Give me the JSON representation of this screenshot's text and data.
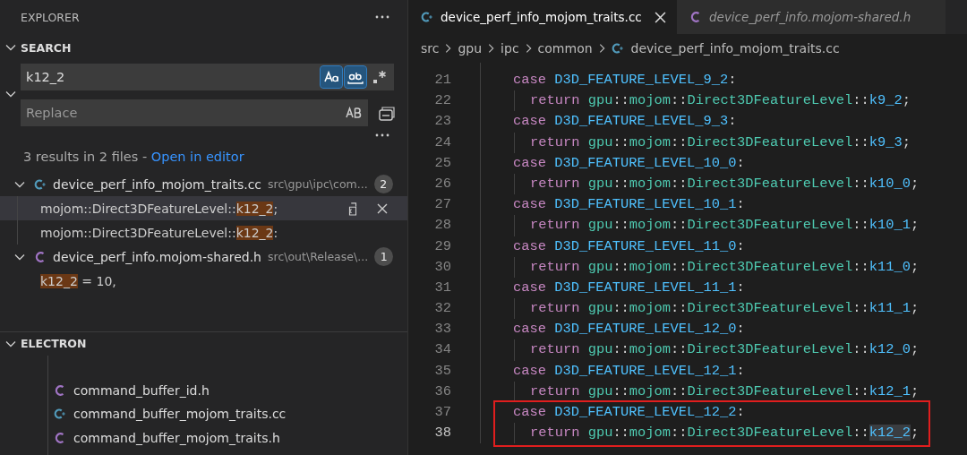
{
  "sidebar": {
    "title": "EXPLORER",
    "search": {
      "heading": "SEARCH",
      "expanded": true,
      "query": "k12_2",
      "match_case": true,
      "whole_word": true,
      "use_regex": false,
      "replace_expanded": true,
      "replace_placeholder": "Replace",
      "preserve_case": false,
      "summary": "3 results in 2 files - ",
      "open_link": "Open in editor",
      "results": [
        {
          "file": "device_perf_info_mojom_traits.cc",
          "kind": "cpp",
          "path": "src\\gpu\\ipc\\com...",
          "count": "2",
          "expanded": true,
          "matches": [
            {
              "before": "mojom::Direct3DFeatureLevel::",
              "match": "k12_2",
              "after": ";",
              "selected": true
            },
            {
              "before": "mojom::Direct3DFeatureLevel::",
              "match": "k12_2",
              "after": ":",
              "selected": false
            }
          ]
        },
        {
          "file": "device_perf_info.mojom-shared.h",
          "kind": "c",
          "path": "src\\out\\Release\\...",
          "count": "1",
          "expanded": true,
          "matches": [
            {
              "match": "k12_2",
              "after": " = 10,",
              "selected": false
            }
          ]
        }
      ]
    },
    "electron": {
      "heading": "ELECTRON",
      "expanded": true,
      "files": [
        {
          "name": "command_buffer_id.h",
          "kind": "c"
        },
        {
          "name": "command_buffer_mojom_traits.cc",
          "kind": "cpp"
        },
        {
          "name": "command_buffer_mojom_traits.h",
          "kind": "c"
        }
      ]
    }
  },
  "editor": {
    "tabs": [
      {
        "label": "device_perf_info_mojom_traits.cc",
        "kind": "cpp",
        "selected": true,
        "preview": false
      },
      {
        "label": "device_perf_info.mojom-shared.h",
        "kind": "c",
        "selected": false,
        "preview": true
      }
    ],
    "breadcrumbs": [
      {
        "label": "src"
      },
      {
        "label": "gpu"
      },
      {
        "label": "ipc"
      },
      {
        "label": "common"
      },
      {
        "label": "device_perf_info_mojom_traits.cc",
        "kind": "cpp"
      }
    ],
    "lines": [
      {
        "number": "21",
        "kind": "case",
        "current": false,
        "framed": false,
        "tokens": [
          {
            "text": "case",
            "kind": "keyword"
          },
          {
            "text": "D3D_FEATURE_LEVEL_9_2",
            "kind": "macro"
          },
          {
            "text": ":",
            "kind": "plain"
          }
        ]
      },
      {
        "number": "22",
        "kind": "return",
        "current": false,
        "framed": false,
        "tokens": [
          {
            "text": "return",
            "kind": "keyword"
          },
          {
            "text": "gpu",
            "kind": "type"
          },
          {
            "text": "::",
            "kind": "plain"
          },
          {
            "text": "mojom",
            "kind": "type"
          },
          {
            "text": "::",
            "kind": "plain"
          },
          {
            "text": "Direct3DFeatureLevel",
            "kind": "type"
          },
          {
            "text": "::",
            "kind": "plain"
          },
          {
            "text": "k9_2",
            "kind": "enum"
          },
          {
            "text": ";",
            "kind": "plain"
          }
        ]
      },
      {
        "number": "23",
        "kind": "case",
        "current": false,
        "framed": false,
        "tokens": [
          {
            "text": "case",
            "kind": "keyword"
          },
          {
            "text": "D3D_FEATURE_LEVEL_9_3",
            "kind": "macro"
          },
          {
            "text": ":",
            "kind": "plain"
          }
        ]
      },
      {
        "number": "24",
        "kind": "return",
        "current": false,
        "framed": false,
        "tokens": [
          {
            "text": "return",
            "kind": "keyword"
          },
          {
            "text": "gpu",
            "kind": "type"
          },
          {
            "text": "::",
            "kind": "plain"
          },
          {
            "text": "mojom",
            "kind": "type"
          },
          {
            "text": "::",
            "kind": "plain"
          },
          {
            "text": "Direct3DFeatureLevel",
            "kind": "type"
          },
          {
            "text": "::",
            "kind": "plain"
          },
          {
            "text": "k9_3",
            "kind": "enum"
          },
          {
            "text": ";",
            "kind": "plain"
          }
        ]
      },
      {
        "number": "25",
        "kind": "case",
        "current": false,
        "framed": false,
        "tokens": [
          {
            "text": "case",
            "kind": "keyword"
          },
          {
            "text": "D3D_FEATURE_LEVEL_10_0",
            "kind": "macro"
          },
          {
            "text": ":",
            "kind": "plain"
          }
        ]
      },
      {
        "number": "26",
        "kind": "return",
        "current": false,
        "framed": false,
        "tokens": [
          {
            "text": "return",
            "kind": "keyword"
          },
          {
            "text": "gpu",
            "kind": "type"
          },
          {
            "text": "::",
            "kind": "plain"
          },
          {
            "text": "mojom",
            "kind": "type"
          },
          {
            "text": "::",
            "kind": "plain"
          },
          {
            "text": "Direct3DFeatureLevel",
            "kind": "type"
          },
          {
            "text": "::",
            "kind": "plain"
          },
          {
            "text": "k10_0",
            "kind": "enum"
          },
          {
            "text": ";",
            "kind": "plain"
          }
        ]
      },
      {
        "number": "27",
        "kind": "case",
        "current": false,
        "framed": false,
        "tokens": [
          {
            "text": "case",
            "kind": "keyword"
          },
          {
            "text": "D3D_FEATURE_LEVEL_10_1",
            "kind": "macro"
          },
          {
            "text": ":",
            "kind": "plain"
          }
        ]
      },
      {
        "number": "28",
        "kind": "return",
        "current": false,
        "framed": false,
        "tokens": [
          {
            "text": "return",
            "kind": "keyword"
          },
          {
            "text": "gpu",
            "kind": "type"
          },
          {
            "text": "::",
            "kind": "plain"
          },
          {
            "text": "mojom",
            "kind": "type"
          },
          {
            "text": "::",
            "kind": "plain"
          },
          {
            "text": "Direct3DFeatureLevel",
            "kind": "type"
          },
          {
            "text": "::",
            "kind": "plain"
          },
          {
            "text": "k10_1",
            "kind": "enum"
          },
          {
            "text": ";",
            "kind": "plain"
          }
        ]
      },
      {
        "number": "29",
        "kind": "case",
        "current": false,
        "framed": false,
        "tokens": [
          {
            "text": "case",
            "kind": "keyword"
          },
          {
            "text": "D3D_FEATURE_LEVEL_11_0",
            "kind": "macro"
          },
          {
            "text": ":",
            "kind": "plain"
          }
        ]
      },
      {
        "number": "30",
        "kind": "return",
        "current": false,
        "framed": false,
        "tokens": [
          {
            "text": "return",
            "kind": "keyword"
          },
          {
            "text": "gpu",
            "kind": "type"
          },
          {
            "text": "::",
            "kind": "plain"
          },
          {
            "text": "mojom",
            "kind": "type"
          },
          {
            "text": "::",
            "kind": "plain"
          },
          {
            "text": "Direct3DFeatureLevel",
            "kind": "type"
          },
          {
            "text": "::",
            "kind": "plain"
          },
          {
            "text": "k11_0",
            "kind": "enum"
          },
          {
            "text": ";",
            "kind": "plain"
          }
        ]
      },
      {
        "number": "31",
        "kind": "case",
        "current": false,
        "framed": false,
        "tokens": [
          {
            "text": "case",
            "kind": "keyword"
          },
          {
            "text": "D3D_FEATURE_LEVEL_11_1",
            "kind": "macro"
          },
          {
            "text": ":",
            "kind": "plain"
          }
        ]
      },
      {
        "number": "32",
        "kind": "return",
        "current": false,
        "framed": false,
        "tokens": [
          {
            "text": "return",
            "kind": "keyword"
          },
          {
            "text": "gpu",
            "kind": "type"
          },
          {
            "text": "::",
            "kind": "plain"
          },
          {
            "text": "mojom",
            "kind": "type"
          },
          {
            "text": "::",
            "kind": "plain"
          },
          {
            "text": "Direct3DFeatureLevel",
            "kind": "type"
          },
          {
            "text": "::",
            "kind": "plain"
          },
          {
            "text": "k11_1",
            "kind": "enum"
          },
          {
            "text": ";",
            "kind": "plain"
          }
        ]
      },
      {
        "number": "33",
        "kind": "case",
        "current": false,
        "framed": false,
        "tokens": [
          {
            "text": "case",
            "kind": "keyword"
          },
          {
            "text": "D3D_FEATURE_LEVEL_12_0",
            "kind": "macro"
          },
          {
            "text": ":",
            "kind": "plain"
          }
        ]
      },
      {
        "number": "34",
        "kind": "return",
        "current": false,
        "framed": false,
        "tokens": [
          {
            "text": "return",
            "kind": "keyword"
          },
          {
            "text": "gpu",
            "kind": "type"
          },
          {
            "text": "::",
            "kind": "plain"
          },
          {
            "text": "mojom",
            "kind": "type"
          },
          {
            "text": "::",
            "kind": "plain"
          },
          {
            "text": "Direct3DFeatureLevel",
            "kind": "type"
          },
          {
            "text": "::",
            "kind": "plain"
          },
          {
            "text": "k12_0",
            "kind": "enum"
          },
          {
            "text": ";",
            "kind": "plain"
          }
        ]
      },
      {
        "number": "35",
        "kind": "case",
        "current": false,
        "framed": false,
        "tokens": [
          {
            "text": "case",
            "kind": "keyword"
          },
          {
            "text": "D3D_FEATURE_LEVEL_12_1",
            "kind": "macro"
          },
          {
            "text": ":",
            "kind": "plain"
          }
        ]
      },
      {
        "number": "36",
        "kind": "return",
        "current": false,
        "framed": false,
        "tokens": [
          {
            "text": "return",
            "kind": "keyword"
          },
          {
            "text": "gpu",
            "kind": "type"
          },
          {
            "text": "::",
            "kind": "plain"
          },
          {
            "text": "mojom",
            "kind": "type"
          },
          {
            "text": "::",
            "kind": "plain"
          },
          {
            "text": "Direct3DFeatureLevel",
            "kind": "type"
          },
          {
            "text": "::",
            "kind": "plain"
          },
          {
            "text": "k12_1",
            "kind": "enum"
          },
          {
            "text": ";",
            "kind": "plain"
          }
        ]
      },
      {
        "number": "37",
        "kind": "case",
        "current": false,
        "framed": true,
        "tokens": [
          {
            "text": "case",
            "kind": "keyword"
          },
          {
            "text": "D3D_FEATURE_LEVEL_12_2",
            "kind": "macro"
          },
          {
            "text": ":",
            "kind": "plain"
          }
        ]
      },
      {
        "number": "38",
        "kind": "return",
        "current": true,
        "framed": true,
        "tokens": [
          {
            "text": "return",
            "kind": "keyword"
          },
          {
            "text": "gpu",
            "kind": "type"
          },
          {
            "text": "::",
            "kind": "plain"
          },
          {
            "text": "mojom",
            "kind": "type"
          },
          {
            "text": "::",
            "kind": "plain"
          },
          {
            "text": "Direct3DFeatureLevel",
            "kind": "type"
          },
          {
            "text": "::",
            "kind": "plain"
          },
          {
            "text": "k12_2",
            "kind": "enum_selected"
          },
          {
            "text": ";",
            "kind": "plain"
          }
        ]
      }
    ]
  }
}
